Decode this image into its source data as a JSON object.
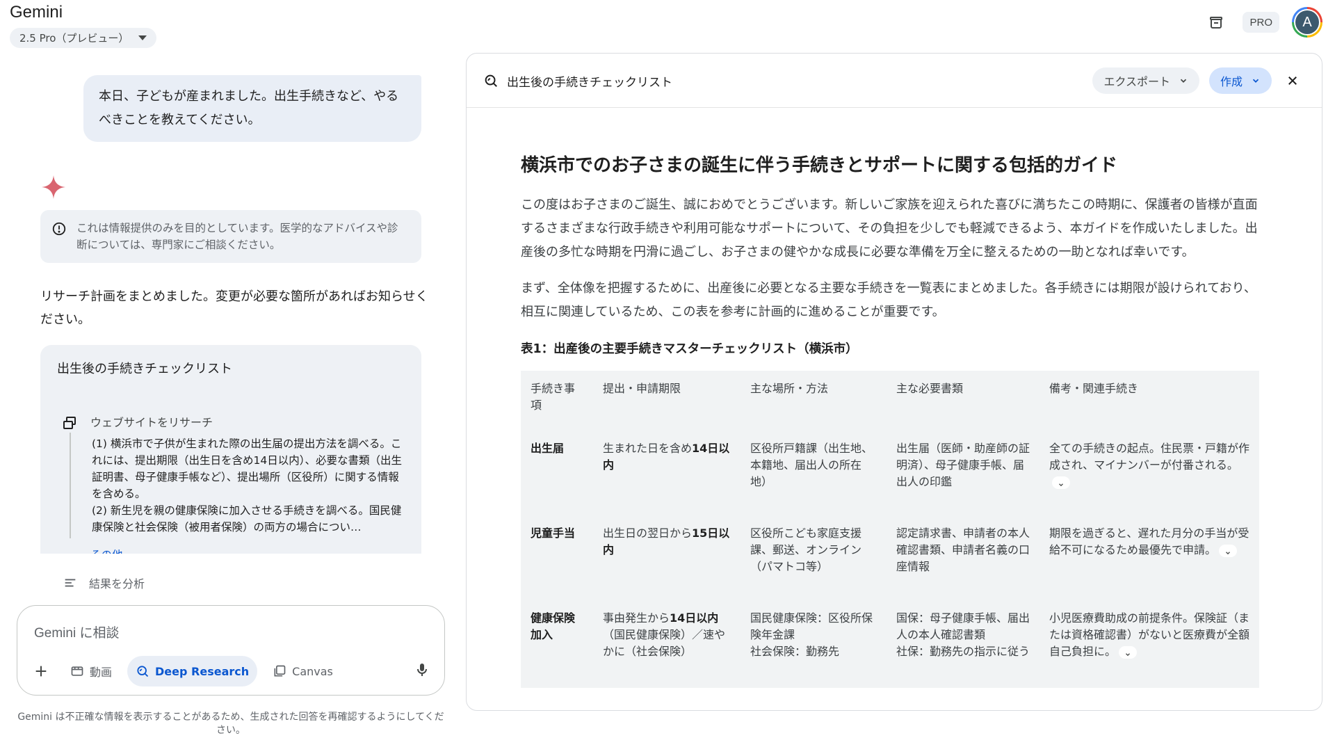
{
  "header": {
    "brand": "Gemini",
    "model": "2.5 Pro（プレビュー）",
    "pro_badge": "PRO",
    "avatar_letter": "A"
  },
  "chat": {
    "user_message": "本日、子どもが産まれました。出生手続きなど、やるべきことを教えてください。",
    "disclaimer": "これは情報提供のみを目的としています。医学的なアドバイスや診断については、専門家にご相談ください。",
    "reply": "リサーチ計画をまとめました。変更が必要な箇所があればお知らせください。",
    "plan": {
      "title": "出生後の手続きチェックリスト",
      "step_label": "ウェブサイトをリサーチ",
      "body": "(1) 横浜市で子供が生まれた際の出生届の提出方法を調べる。これには、提出期限（出生日を含め14日以内）、必要な書類（出生証明書、母子健康手帳など）、提出場所（区役所）に関する情報を含める。\n(2) 新生児を親の健康保険に加入させる手続きを調べる。国民健康保険と社会保険（被用者保険）の両方の場合につい…",
      "more_link": "その他",
      "analyze_label": "結果を分析"
    }
  },
  "composer": {
    "placeholder": "Gemini に相談",
    "tools": {
      "video": "動画",
      "deep_research": "Deep Research",
      "canvas": "Canvas"
    },
    "footer_note": "Gemini は不正確な情報を表示することがあるため、生成された回答を再確認するようにしてください。"
  },
  "panel": {
    "title": "出生後の手続きチェックリスト",
    "export_label": "エクスポート",
    "create_label": "作成",
    "doc": {
      "heading": "横浜市でのお子さまの誕生に伴う手続きとサポートに関する包括的ガイド",
      "para1": "この度はお子さまのご誕生、誠におめでとうございます。新しいご家族を迎えられた喜びに満ちたこの時期に、保護者の皆様が直面するさまざまな行政手続きや利用可能なサポートについて、その負担を少しでも軽減できるよう、本ガイドを作成いたしました。出産後の多忙な時期を円滑に過ごし、お子さまの健やかな成長に必要な準備を万全に整えるための一助となれば幸いです。",
      "para2": "まず、全体像を把握するために、出産後に必要となる主要な手続きを一覧表にまとめました。各手続きには期限が設けられており、相互に関連しているため、この表を参考に計画的に進めることが重要です。",
      "table_caption": "表1：出産後の主要手続きマスターチェックリスト（横浜市）",
      "table": {
        "headers": [
          "手続き事項",
          "提出・申請期限",
          "主な場所・方法",
          "主な必要書類",
          "備考・関連手続き"
        ],
        "rows": [
          {
            "item": "出生届",
            "deadline_pre": "生まれた日を含め",
            "deadline_bold": "14日以内",
            "deadline_post": "",
            "place": "区役所戸籍課（出生地、本籍地、届出人の所在地）",
            "docs": "出生届（医師・助産師の証明済）、母子健康手帳、届出人の印鑑",
            "notes": "全ての手続きの起点。住民票・戸籍が作成され、マイナンバーが付番される。"
          },
          {
            "item": "児童手当",
            "deadline_pre": "出生日の翌日から",
            "deadline_bold": "15日以内",
            "deadline_post": "",
            "place": "区役所こども家庭支援課、郵送、オンライン（パマトコ等）",
            "docs": "認定請求書、申請者の本人確認書類、申請者名義の口座情報",
            "notes": "期限を過ぎると、遅れた月分の手当が受給不可になるため最優先で申請。"
          },
          {
            "item": "健康保険加入",
            "deadline_pre": "事由発生から",
            "deadline_bold": "14日以内",
            "deadline_post": "（国民健康保険）／速やかに（社会保険）",
            "place": "国民健康保険：区役所保険年金課\n社会保険：勤務先",
            "docs": "国保：母子健康手帳、届出人の本人確認書類\n社保：勤務先の指示に従う",
            "notes": "小児医療費助成の前提条件。保険証（または資格確認書）がないと医療費が全額自己負担に。"
          }
        ]
      }
    }
  },
  "colors": {
    "accent_blue": "#0b57d0",
    "pill_bg": "#eef1f5",
    "create_bg": "#d3e3fd",
    "spark": "#d96570"
  }
}
